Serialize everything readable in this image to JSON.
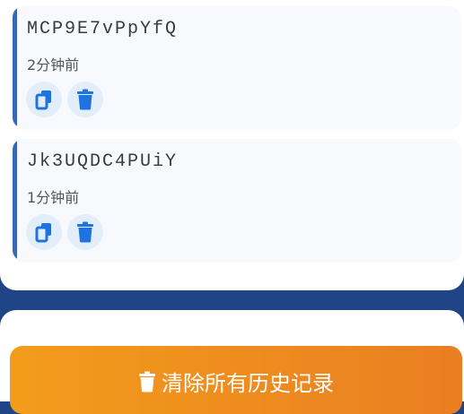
{
  "history": [
    {
      "password": "MCP9E7vPpYfQ",
      "time": "2分钟前"
    },
    {
      "password": "Jk3UQDC4PUiY",
      "time": "1分钟前"
    }
  ],
  "clear_button": {
    "label": "清除所有历史记录"
  },
  "colors": {
    "accent_blue": "#1f4587",
    "icon_blue": "#1e73e0",
    "card_bar": "#3b66b8",
    "clear_start": "#f39c1b",
    "clear_end": "#ea7e22"
  },
  "icons": {
    "copy": "copy-icon",
    "delete": "trash-icon",
    "clear": "trash-icon"
  }
}
